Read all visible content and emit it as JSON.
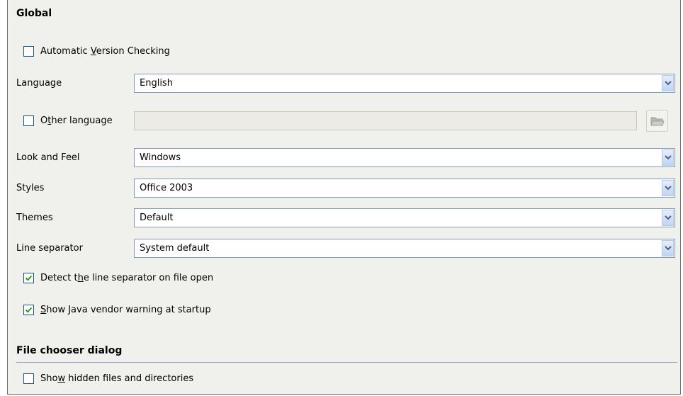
{
  "global": {
    "heading": "Global",
    "auto_version_check": {
      "pre": "Automatic ",
      "key": "V",
      "post": "ersion Checking",
      "checked": false
    },
    "language": {
      "label": "Language",
      "value": "English"
    },
    "other_language": {
      "pre": "O",
      "key": "t",
      "post": "her language",
      "checked": false,
      "value": ""
    },
    "look_and_feel": {
      "label": "Look and Feel",
      "value": "Windows"
    },
    "styles": {
      "label": "Styles",
      "value": "Office 2003"
    },
    "themes": {
      "label": "Themes",
      "value": "Default"
    },
    "line_separator": {
      "label": "Line separator",
      "value": "System default"
    },
    "detect_separator": {
      "pre": "Detect t",
      "key": "h",
      "post": "e line separator on file open",
      "checked": true
    },
    "java_warning": {
      "pre": "",
      "key": "S",
      "post": "how Java vendor warning at startup",
      "checked": true
    }
  },
  "file_chooser": {
    "heading": "File chooser dialog",
    "show_hidden": {
      "pre": "Sho",
      "key": "w",
      "post": " hidden files and directories",
      "checked": false
    }
  },
  "icons": {
    "dropdown": "chevron-down-icon",
    "folder": "folder-icon",
    "check": "checkmark-icon"
  },
  "colors": {
    "panel_bg": "#f0f0ed",
    "checkbox_border": "#1c5180",
    "check_green": "#21a121",
    "field_border": "#7f9db9",
    "separator": "#8ea1c2"
  }
}
